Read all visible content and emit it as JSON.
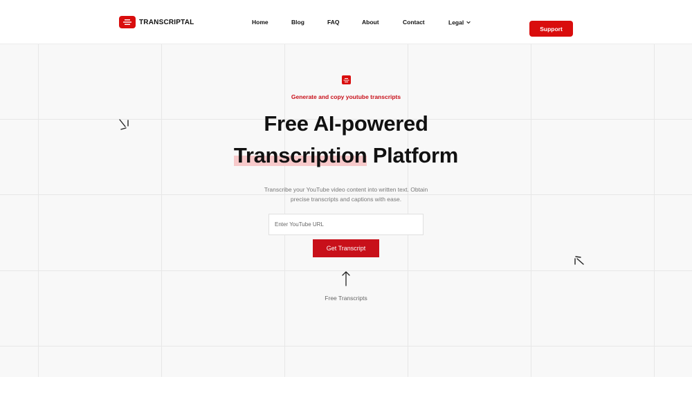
{
  "brand": {
    "name": "TRANSCRIPTAL",
    "accent_color": "#d90d0d"
  },
  "nav": {
    "items": [
      {
        "label": "Home"
      },
      {
        "label": "Blog"
      },
      {
        "label": "FAQ"
      },
      {
        "label": "About"
      },
      {
        "label": "Contact"
      },
      {
        "label": "Legal",
        "icon": "chevron-down-icon"
      }
    ],
    "support_label": "Support"
  },
  "hero": {
    "eyebrow": "Generate and copy youtube transcripts",
    "title_line1": "Free AI-powered",
    "title_highlight": "Transcription",
    "title_rest": "Platform",
    "description_line1": "Transcribe your YouTube video content into written text. Obtain",
    "description_line2": "precise transcripts and captions with ease.",
    "url_placeholder": "Enter YouTube URL",
    "url_value": "",
    "submit_label": "Get Transcript",
    "footnote": "Free Transcripts",
    "icons": [
      "logo-icon",
      "arrow-up-icon",
      "sparkle-icon"
    ]
  }
}
